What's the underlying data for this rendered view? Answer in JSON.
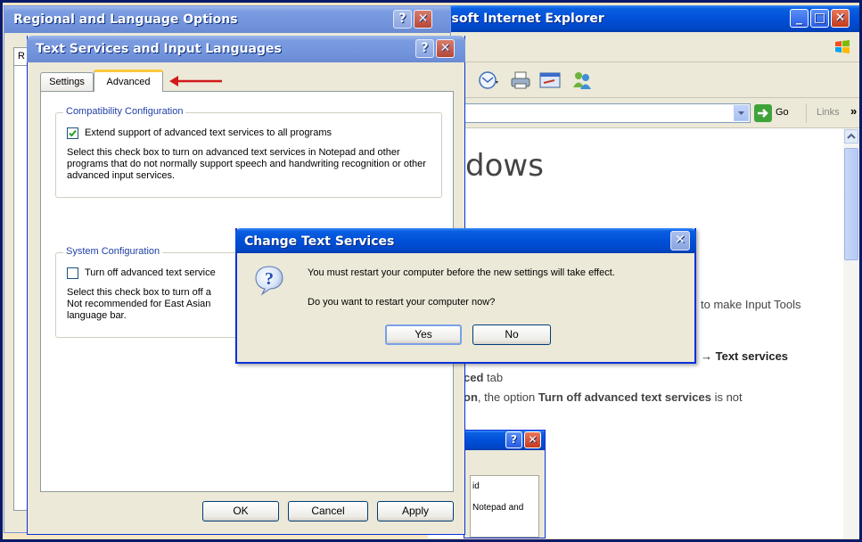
{
  "ie_window": {
    "title": "rosoft Internet Explorer",
    "go_label": "Go",
    "links_label": "Links",
    "links_chevron": "»",
    "heading_fragment": "dows",
    "line1_text": "to make Input Tools",
    "line2_arrow": "→ Text services",
    "line3_bold": "ced",
    "line3_rest": " tab",
    "line4_bold1": "on",
    "line4_rest1": ", the option ",
    "line4_bold2": "Turn off advanced text services",
    "line4_rest2": " is not",
    "bg_dialog_text1": "Notepad and",
    "bg_dialog_text2": "id"
  },
  "regional_window": {
    "title": "Regional and Language Options",
    "tab_fragment": "R"
  },
  "text_services_window": {
    "title": "Text Services and Input Languages",
    "tabs": [
      {
        "label": "Settings"
      },
      {
        "label": "Advanced"
      }
    ],
    "compat_group": {
      "legend": "Compatibility Configuration",
      "checkbox_label": "Extend support of advanced text services to all programs",
      "checked": true,
      "description": "Select this check box to turn on advanced text services in Notepad and other programs that do not normally support speech and handwriting recognition or other advanced input services."
    },
    "system_group": {
      "legend": "System Configuration",
      "checkbox_label": "Turn off advanced text service",
      "checked": false,
      "description_line1": "Select this check box to turn off a",
      "description_line2": "Not recommended for East Asian",
      "description_line3": "language bar."
    },
    "buttons": {
      "ok": "OK",
      "cancel": "Cancel",
      "apply": "Apply"
    }
  },
  "change_text_services_dialog": {
    "title": "Change Text Services",
    "message1": "You must restart your computer before the new settings will take effect.",
    "message2": "Do you want to restart your computer now?",
    "yes_label": "Yes",
    "no_label": "No",
    "icon": "question-icon"
  },
  "annotation": {
    "arrow_color": "#d11a1a"
  }
}
